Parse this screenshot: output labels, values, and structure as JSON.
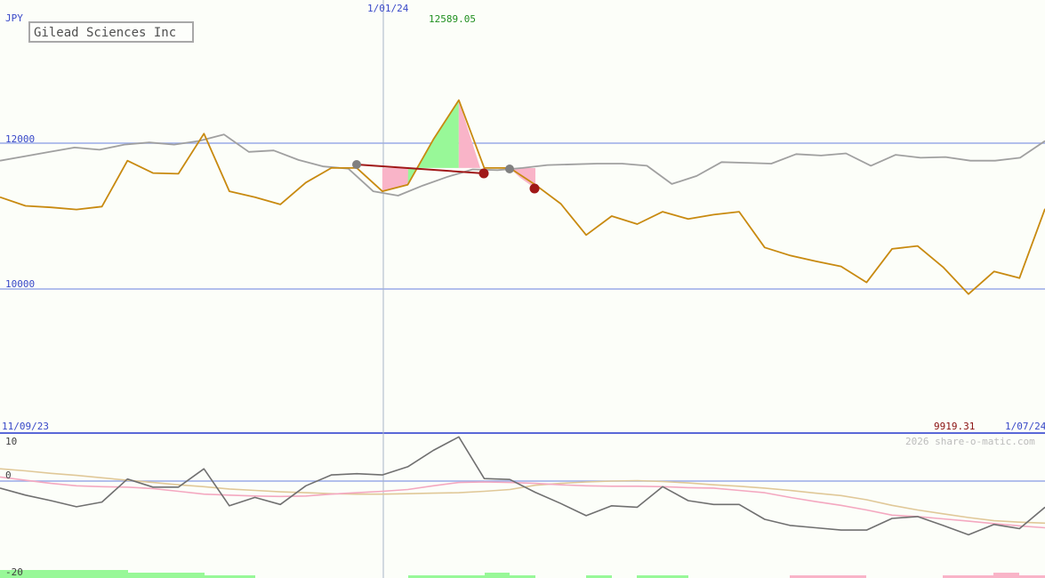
{
  "chart_data": {
    "type": "line",
    "title": "Gilead Sciences Inc",
    "currency": "JPY",
    "watermark": "2026 share-o-matic.com",
    "date_start": "11/09/23",
    "date_end": "1/07/24",
    "marker_date": "1/01/24",
    "high_label": "12589.05",
    "low_label": "9919.31",
    "upper_axis": {
      "ticks": [
        "12000",
        "10000"
      ],
      "ylim": [
        8000,
        12600
      ]
    },
    "lower_axis": {
      "ticks": [
        "10",
        "0",
        "-20"
      ],
      "ylim": [
        -20,
        10
      ]
    },
    "price_series": [
      11260,
      11140,
      11120,
      11090,
      11130,
      11760,
      11590,
      11580,
      12130,
      11340,
      11260,
      11160,
      11460,
      11660,
      11660,
      11340,
      11430,
      12050,
      12590,
      11660,
      11660,
      11430,
      11170,
      10740,
      11000,
      10890,
      11060,
      10960,
      11020,
      11060,
      10570,
      10460,
      10380,
      10310,
      10090,
      10550,
      10590,
      10300,
      9930,
      10240,
      10150,
      11100
    ],
    "compare_series": [
      11760,
      11820,
      11880,
      11940,
      11910,
      11980,
      12010,
      11980,
      12030,
      12120,
      11880,
      11900,
      11770,
      11680,
      11650,
      11340,
      11280,
      11420,
      11540,
      11640,
      11630,
      11660,
      11700,
      11710,
      11720,
      11720,
      11690,
      11440,
      11550,
      11740,
      11730,
      11720,
      11850,
      11830,
      11860,
      11690,
      11840,
      11800,
      11810,
      11760,
      11760,
      11800,
      12030
    ],
    "osc_series": [
      -1.5,
      -3,
      -4.2,
      -5.5,
      -4.5,
      0.5,
      -1.3,
      -1.3,
      3,
      -5.3,
      -3.5,
      -5,
      -1,
      1.5,
      1.8,
      1.5,
      3.5,
      7.5,
      10.8,
      0.6,
      0.4,
      -2.4,
      -4.8,
      -7.4,
      -5.3,
      -5.6,
      -1.2,
      -4.2,
      -5,
      -5,
      -8.2,
      -9.5,
      -10,
      -10.5,
      -10.5,
      -8,
      -7.6,
      -9.5,
      -11.5,
      -9.3,
      -10.2,
      -5.6
    ],
    "osc_ma_fast": [
      1,
      0.2,
      -0.5,
      -1,
      -1.2,
      -1.3,
      -1.6,
      -2.2,
      -2.8,
      -3,
      -3.2,
      -3.3,
      -3.2,
      -2.8,
      -2.5,
      -2.2,
      -1.8,
      -1,
      -0.3,
      -0.2,
      -0.3,
      -0.5,
      -0.8,
      -1,
      -1.1,
      -1.1,
      -1.2,
      -1.4,
      -1.5,
      -2,
      -2.5,
      -3.5,
      -4.4,
      -5.2,
      -6.2,
      -7.3,
      -7.6,
      -8.1,
      -8.6,
      -9.1,
      -9.6,
      -10
    ],
    "osc_ma_slow": [
      3,
      2.5,
      1.9,
      1.4,
      0.8,
      0.2,
      -0.3,
      -0.8,
      -1.2,
      -1.7,
      -2,
      -2.3,
      -2.5,
      -2.7,
      -2.8,
      -2.8,
      -2.7,
      -2.6,
      -2.5,
      -2.2,
      -1.8,
      -0.9,
      -0.5,
      -0.2,
      0,
      0.1,
      -0.1,
      -0.4,
      -0.8,
      -1.1,
      -1.5,
      -2,
      -2.6,
      -3.1,
      -4,
      -5.2,
      -6.2,
      -7,
      -7.8,
      -8.5,
      -8.8,
      -9
    ]
  }
}
